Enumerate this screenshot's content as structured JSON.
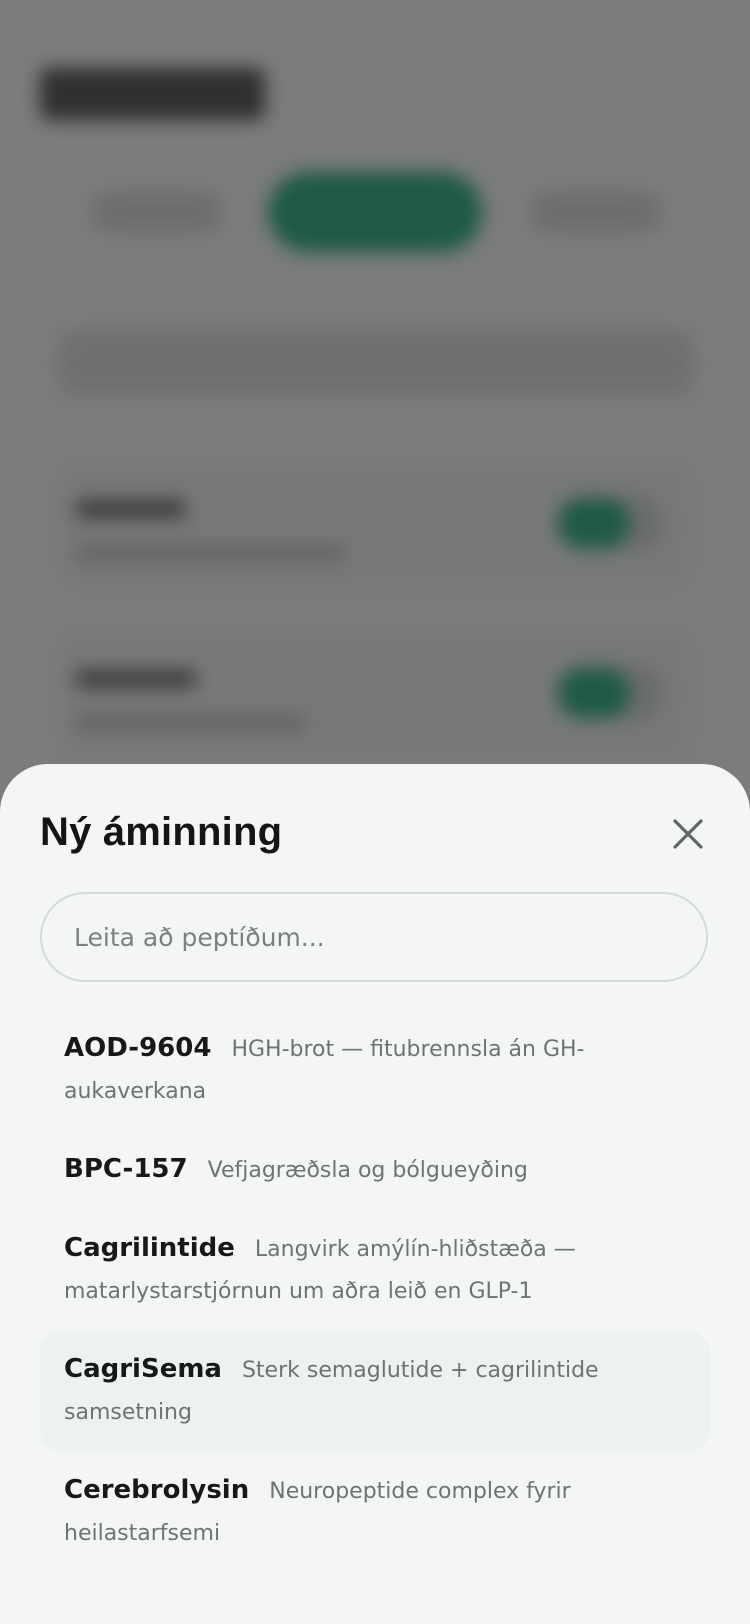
{
  "sheet": {
    "title": "Ný áminning",
    "close_icon": "close-icon",
    "search": {
      "placeholder": "Leita að peptíðum...",
      "value": ""
    },
    "results": [
      {
        "name": "AOD-9604",
        "description": "HGH-brot — fitubrennsla án GH-aukaverkana",
        "highlighted": false
      },
      {
        "name": "BPC-157",
        "description": "Vefjagræðsla og bólgueyðing",
        "highlighted": false
      },
      {
        "name": "Cagrilintide",
        "description": "Langvirk amýlín-hliðstæða — matarlystarstjórnun um aðra leið en GLP-1",
        "highlighted": false
      },
      {
        "name": "CagriSema",
        "description": "Sterk semaglutide + cagrilintide samsetning",
        "highlighted": true
      },
      {
        "name": "Cerebrolysin",
        "description": "Neuropeptide complex fyrir heilastarfsemi",
        "highlighted": false
      }
    ]
  },
  "colors": {
    "accent": "#1e5a47",
    "sheet_background": "#f4f6f5",
    "scrim": "#7b7c7b",
    "text_primary": "#171919",
    "text_secondary": "#6d7472",
    "highlight_row": "#edf1f0"
  }
}
